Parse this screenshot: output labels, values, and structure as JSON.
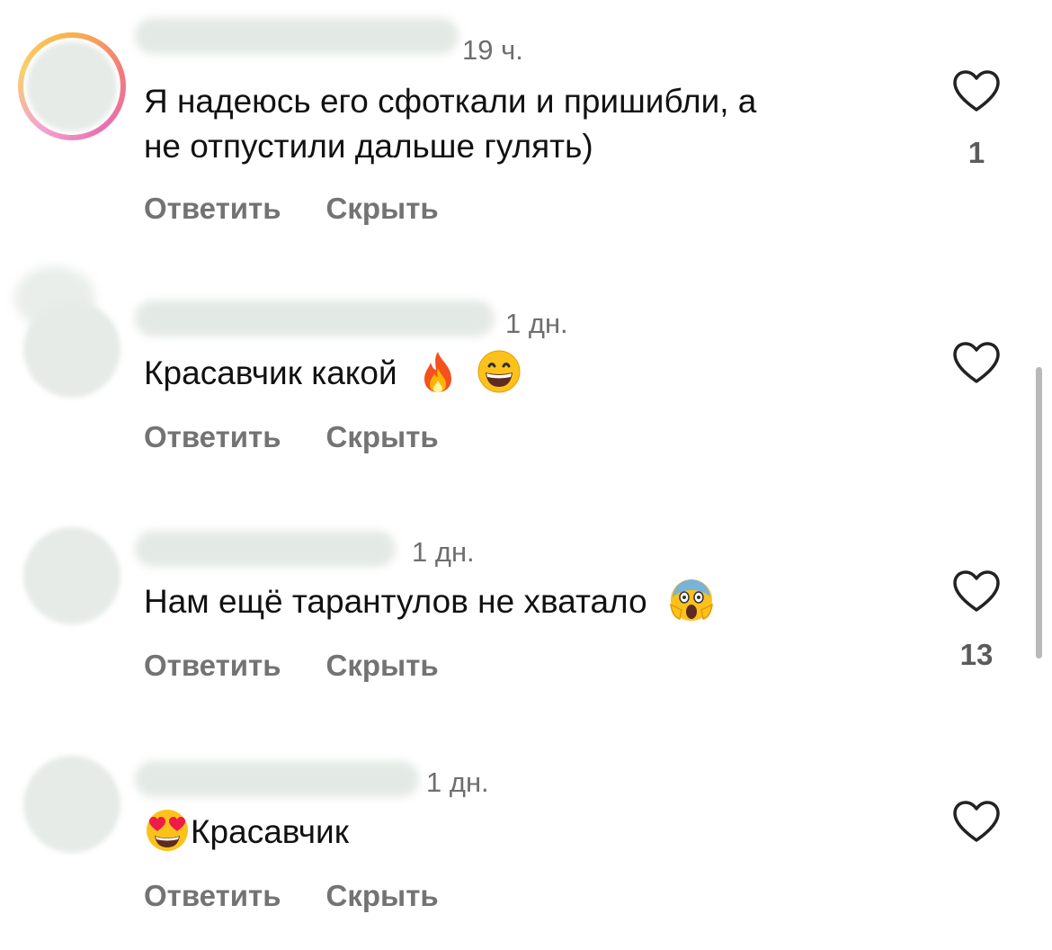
{
  "comments": [
    {
      "time": "19 ч.",
      "text": "Я надеюсь его сфоткали и пришибли, а\nне отпустили дальше гулять)",
      "text_line1": "Я надеюсь его сфоткали и пришибли, а",
      "text_line2": "не отпустили дальше гулять)",
      "reply_label": "Ответить",
      "hide_label": "Скрыть",
      "likes": "1",
      "has_story_ring": true
    },
    {
      "time": "1 дн.",
      "text": "Красавчик какой",
      "emojis": [
        "fire-emoji",
        "grinning-face-emoji"
      ],
      "reply_label": "Ответить",
      "hide_label": "Скрыть",
      "likes": ""
    },
    {
      "time": "1 дн.",
      "text": "Нам ещё тарантулов не хватало",
      "emojis": [
        "screaming-face-emoji"
      ],
      "reply_label": "Ответить",
      "hide_label": "Скрыть",
      "likes": "13"
    },
    {
      "time": "1 дн.",
      "text": "Красавчик",
      "emojis": [
        "heart-eyes-emoji"
      ],
      "reply_label": "Ответить",
      "hide_label": "Скрыть",
      "likes": ""
    }
  ],
  "colors": {
    "text": "#111111",
    "secondary": "#737373",
    "time": "#6e6e6e",
    "blur": "#e3e9e4"
  }
}
